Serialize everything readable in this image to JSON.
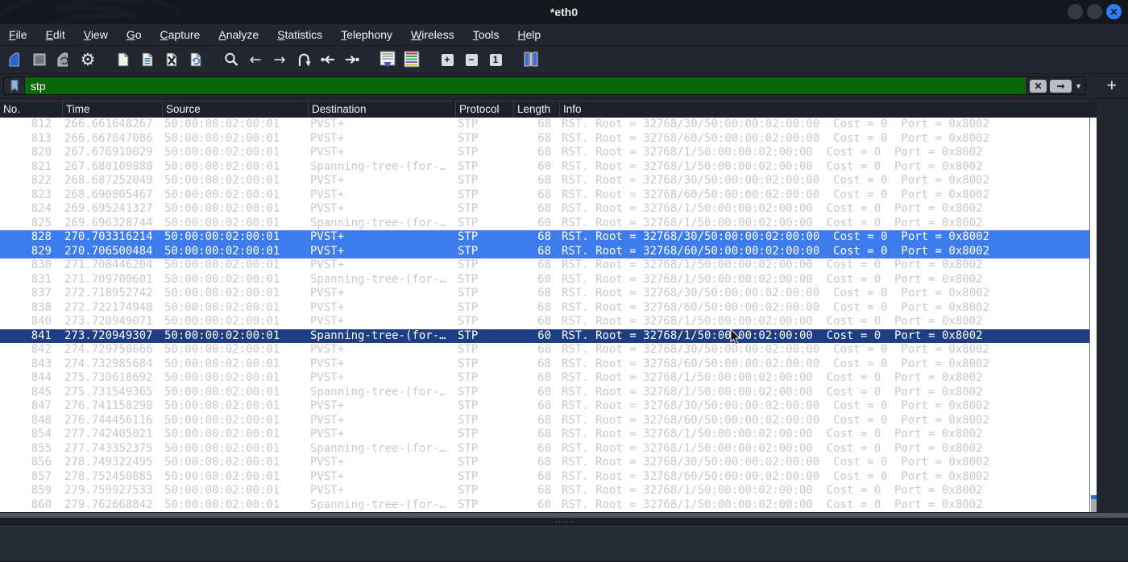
{
  "window": {
    "title": "*eth0"
  },
  "titlebar_buttons": {
    "close_glyph": "✕"
  },
  "menu": {
    "items": [
      "File",
      "Edit",
      "View",
      "Go",
      "Capture",
      "Analyze",
      "Statistics",
      "Telephony",
      "Wireless",
      "Tools",
      "Help"
    ]
  },
  "toolbar": {
    "icons": [
      "start-capture",
      "stop-capture",
      "restart-capture",
      "capture-options",
      "open-file",
      "save-file",
      "close-file",
      "reload-file",
      "find-packet",
      "go-back",
      "go-forward",
      "go-to-packet",
      "go-first-packet",
      "go-last-packet",
      "auto-scroll",
      "colorize-packets",
      "zoom-in",
      "zoom-out",
      "normal-size",
      "resize-columns"
    ],
    "zoom_in_glyph": "+",
    "zoom_out_glyph": "−",
    "normal_size_glyph": "1",
    "back_glyph": "←",
    "forward_glyph": "→",
    "gear_glyph": "⚙"
  },
  "filter": {
    "value": "stp",
    "clear_glyph": "✕",
    "apply_glyph": "➞",
    "caret_glyph": "▼",
    "add_button_glyph": "+"
  },
  "columns": [
    "No.",
    "Time",
    "Source",
    "Destination",
    "Protocol",
    "Length",
    "Info"
  ],
  "splitter": {
    "handle": "⋅⋅⋅⋅⋅⋅"
  },
  "ui_colors": {
    "selected_row_bg": "#3d7cec",
    "current_row_bg": "#1e3d82",
    "filter_field_bg": "#096909",
    "row_text": "#c8c8c8",
    "close_button": "#2f7df6"
  },
  "packets": [
    {
      "no": "812",
      "time": "266.661648267",
      "source": "50:00:00:02:00:01",
      "destination": "PVST+",
      "protocol": "STP",
      "length": "68",
      "info": "RST. Root = 32768/30/50:00:00:02:00:00  Cost = 0  Port = 0x8002",
      "state": "normal"
    },
    {
      "no": "813",
      "time": "266.667847086",
      "source": "50:00:00:02:00:01",
      "destination": "PVST+",
      "protocol": "STP",
      "length": "68",
      "info": "RST. Root = 32768/60/50:00:00:02:00:00  Cost = 0  Port = 0x8002",
      "state": "normal"
    },
    {
      "no": "820",
      "time": "267.676910029",
      "source": "50:00:00:02:00:01",
      "destination": "PVST+",
      "protocol": "STP",
      "length": "68",
      "info": "RST. Root = 32768/1/50:00:00:02:00:00  Cost = 0  Port = 0x8002",
      "state": "normal"
    },
    {
      "no": "821",
      "time": "267.680109888",
      "source": "50:00:00:02:00:01",
      "destination": "Spanning-tree-(for-…",
      "protocol": "STP",
      "length": "60",
      "info": "RST. Root = 32768/1/50:00:00:02:00:00  Cost = 0  Port = 0x8002",
      "state": "normal"
    },
    {
      "no": "822",
      "time": "268.687252049",
      "source": "50:00:00:02:00:01",
      "destination": "PVST+",
      "protocol": "STP",
      "length": "68",
      "info": "RST. Root = 32768/30/50:00:00:02:00:00  Cost = 0  Port = 0x8002",
      "state": "normal"
    },
    {
      "no": "823",
      "time": "268.690805467",
      "source": "50:00:00:02:00:01",
      "destination": "PVST+",
      "protocol": "STP",
      "length": "68",
      "info": "RST. Root = 32768/60/50:00:00:02:00:00  Cost = 0  Port = 0x8002",
      "state": "normal"
    },
    {
      "no": "824",
      "time": "269.695241327",
      "source": "50:00:00:02:00:01",
      "destination": "PVST+",
      "protocol": "STP",
      "length": "68",
      "info": "RST. Root = 32768/1/50:00:00:02:00:00  Cost = 0  Port = 0x8002",
      "state": "normal"
    },
    {
      "no": "825",
      "time": "269.696328744",
      "source": "50:00:00:02:00:01",
      "destination": "Spanning-tree-(for-…",
      "protocol": "STP",
      "length": "60",
      "info": "RST. Root = 32768/1/50:00:00:02:00:00  Cost = 0  Port = 0x8002",
      "state": "normal"
    },
    {
      "no": "828",
      "time": "270.703316214",
      "source": "50:00:00:02:00:01",
      "destination": "PVST+",
      "protocol": "STP",
      "length": "68",
      "info": "RST. Root = 32768/30/50:00:00:02:00:00  Cost = 0  Port = 0x8002",
      "state": "selected"
    },
    {
      "no": "829",
      "time": "270.706500484",
      "source": "50:00:00:02:00:01",
      "destination": "PVST+",
      "protocol": "STP",
      "length": "68",
      "info": "RST. Root = 32768/60/50:00:00:02:00:00  Cost = 0  Port = 0x8002",
      "state": "selected"
    },
    {
      "no": "830",
      "time": "271.708446204",
      "source": "50:00:00:02:00:01",
      "destination": "PVST+",
      "protocol": "STP",
      "length": "68",
      "info": "RST. Root = 32768/1/50:00:00:02:00:00  Cost = 0  Port = 0x8002",
      "state": "normal"
    },
    {
      "no": "831",
      "time": "271.709700601",
      "source": "50:00:00:02:00:01",
      "destination": "Spanning-tree-(for-…",
      "protocol": "STP",
      "length": "60",
      "info": "RST. Root = 32768/1/50:00:00:02:00:00  Cost = 0  Port = 0x8002",
      "state": "normal"
    },
    {
      "no": "837",
      "time": "272.718952742",
      "source": "50:00:00:02:00:01",
      "destination": "PVST+",
      "protocol": "STP",
      "length": "68",
      "info": "RST. Root = 32768/30/50:00:00:02:00:00  Cost = 0  Port = 0x8002",
      "state": "normal"
    },
    {
      "no": "838",
      "time": "272.722174948",
      "source": "50:00:00:02:00:01",
      "destination": "PVST+",
      "protocol": "STP",
      "length": "68",
      "info": "RST. Root = 32768/60/50:00:00:02:00:00  Cost = 0  Port = 0x8002",
      "state": "normal"
    },
    {
      "no": "840",
      "time": "273.720949071",
      "source": "50:00:00:02:00:01",
      "destination": "PVST+",
      "protocol": "STP",
      "length": "68",
      "info": "RST. Root = 32768/1/50:00:00:02:00:00  Cost = 0  Port = 0x8002",
      "state": "normal"
    },
    {
      "no": "841",
      "time": "273.720949307",
      "source": "50:00:00:02:00:01",
      "destination": "Spanning-tree-(for-…",
      "protocol": "STP",
      "length": "60",
      "info": "RST. Root = 32768/1/50:00:00:02:00:00  Cost = 0  Port = 0x8002",
      "state": "current"
    },
    {
      "no": "842",
      "time": "274.729750666",
      "source": "50:00:00:02:00:01",
      "destination": "PVST+",
      "protocol": "STP",
      "length": "68",
      "info": "RST. Root = 32768/30/50:00:00:02:00:00  Cost = 0  Port = 0x8002",
      "state": "normal"
    },
    {
      "no": "843",
      "time": "274.732985684",
      "source": "50:00:00:02:00:01",
      "destination": "PVST+",
      "protocol": "STP",
      "length": "68",
      "info": "RST. Root = 32768/60/50:00:00:02:00:00  Cost = 0  Port = 0x8002",
      "state": "normal"
    },
    {
      "no": "844",
      "time": "275.730618692",
      "source": "50:00:00:02:00:01",
      "destination": "PVST+",
      "protocol": "STP",
      "length": "68",
      "info": "RST. Root = 32768/1/50:00:00:02:00:00  Cost = 0  Port = 0x8002",
      "state": "normal"
    },
    {
      "no": "845",
      "time": "275.731549365",
      "source": "50:00:00:02:00:01",
      "destination": "Spanning-tree-(for-…",
      "protocol": "STP",
      "length": "60",
      "info": "RST. Root = 32768/1/50:00:00:02:00:00  Cost = 0  Port = 0x8002",
      "state": "normal"
    },
    {
      "no": "847",
      "time": "276.741158298",
      "source": "50:00:00:02:00:01",
      "destination": "PVST+",
      "protocol": "STP",
      "length": "68",
      "info": "RST. Root = 32768/30/50:00:00:02:00:00  Cost = 0  Port = 0x8002",
      "state": "normal"
    },
    {
      "no": "848",
      "time": "276.744456116",
      "source": "50:00:00:02:00:01",
      "destination": "PVST+",
      "protocol": "STP",
      "length": "68",
      "info": "RST. Root = 32768/60/50:00:00:02:00:00  Cost = 0  Port = 0x8002",
      "state": "normal"
    },
    {
      "no": "854",
      "time": "277.742405021",
      "source": "50:00:00:02:00:01",
      "destination": "PVST+",
      "protocol": "STP",
      "length": "68",
      "info": "RST. Root = 32768/1/50:00:00:02:00:00  Cost = 0  Port = 0x8002",
      "state": "normal"
    },
    {
      "no": "855",
      "time": "277.743352375",
      "source": "50:00:00:02:00:01",
      "destination": "Spanning-tree-(for-…",
      "protocol": "STP",
      "length": "60",
      "info": "RST. Root = 32768/1/50:00:00:02:00:00  Cost = 0  Port = 0x8002",
      "state": "normal"
    },
    {
      "no": "856",
      "time": "278.749322495",
      "source": "50:00:00:02:00:01",
      "destination": "PVST+",
      "protocol": "STP",
      "length": "68",
      "info": "RST. Root = 32768/30/50:00:00:02:00:00  Cost = 0  Port = 0x8002",
      "state": "normal"
    },
    {
      "no": "857",
      "time": "278.752450885",
      "source": "50:00:00:02:00:01",
      "destination": "PVST+",
      "protocol": "STP",
      "length": "68",
      "info": "RST. Root = 32768/60/50:00:00:02:00:00  Cost = 0  Port = 0x8002",
      "state": "normal"
    },
    {
      "no": "859",
      "time": "279.759927533",
      "source": "50:00:00:02:00:01",
      "destination": "PVST+",
      "protocol": "STP",
      "length": "68",
      "info": "RST. Root = 32768/1/50:00:00:02:00:00  Cost = 0  Port = 0x8002",
      "state": "normal"
    },
    {
      "no": "860",
      "time": "279.762668842",
      "source": "50:00:00:02:00:01",
      "destination": "Spanning-tree-(for-…",
      "protocol": "STP",
      "length": "60",
      "info": "RST. Root = 32768/1/50:00:00:02:00:00  Cost = 0  Port = 0x8002",
      "state": "normal"
    }
  ]
}
